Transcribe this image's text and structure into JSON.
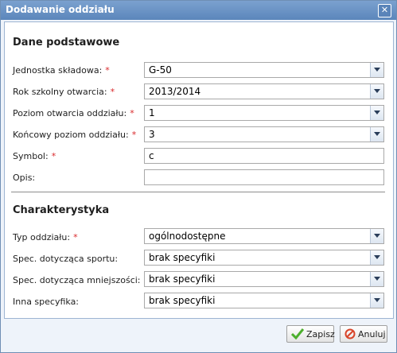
{
  "window": {
    "title": "Dodawanie oddziału",
    "close_glyph": "✕"
  },
  "sections": {
    "basic": "Dane podstawowe",
    "characteristics": "Charakterystyka"
  },
  "required_marker": "*",
  "fields": {
    "unit": {
      "label": "Jednostka składowa:",
      "value": "G-50"
    },
    "year": {
      "label": "Rok szkolny otwarcia:",
      "value": "2013/2014"
    },
    "open_level": {
      "label": "Poziom otwarcia oddziału:",
      "value": "1"
    },
    "end_level": {
      "label": "Końcowy poziom oddziału:",
      "value": "3"
    },
    "symbol": {
      "label": "Symbol:",
      "value": "c"
    },
    "description": {
      "label": "Opis:",
      "value": ""
    },
    "type": {
      "label": "Typ oddziału:",
      "value": "ogólnodostępne"
    },
    "sport": {
      "label": "Spec. dotycząca sportu:",
      "value": "brak specyfiki"
    },
    "minority": {
      "label": "Spec. dotycząca mniejszości:",
      "value": "brak specyfiki"
    },
    "other": {
      "label": "Inna specyfika:",
      "value": "brak specyfiki"
    }
  },
  "buttons": {
    "save": "Zapisz",
    "cancel": "Anuluj"
  },
  "icons": {
    "close": "close-icon",
    "dropdown": "chevron-down-icon",
    "save": "check-icon",
    "cancel": "cancel-icon"
  },
  "colors": {
    "titlebar": "#6a93c6",
    "required": "#d9272a",
    "save_icon": "#4caf2d",
    "cancel_icon": "#d9452a"
  }
}
